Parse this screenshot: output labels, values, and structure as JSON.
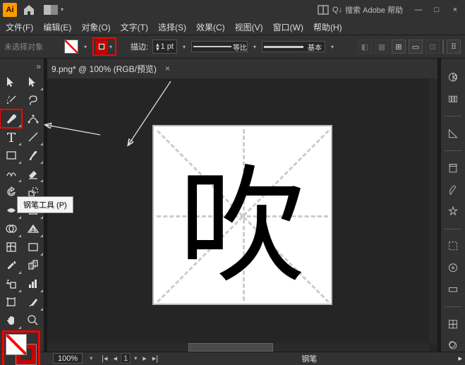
{
  "app": {
    "logo": "Ai"
  },
  "search": {
    "prefix": "Q",
    "placeholder": "搜索 Adobe 帮助"
  },
  "menus": [
    "文件(F)",
    "编辑(E)",
    "对象(O)",
    "文字(T)",
    "选择(S)",
    "效果(C)",
    "视图(V)",
    "窗口(W)",
    "帮助(H)"
  ],
  "options": {
    "noselect": "未选择对象",
    "stroke_label": "描边:",
    "stroke_pt": "1 pt",
    "stroke_style": "等比",
    "profile": "基本"
  },
  "tab": {
    "title": "9.png* @ 100% (RGB/预览)",
    "close": "×"
  },
  "tooltip": "钢笔工具 (P)",
  "character": "吹",
  "status": {
    "zoom": "100%",
    "page": "1",
    "tool": "钢笔"
  },
  "win": {
    "min": "—",
    "max": "□",
    "close": "×"
  }
}
